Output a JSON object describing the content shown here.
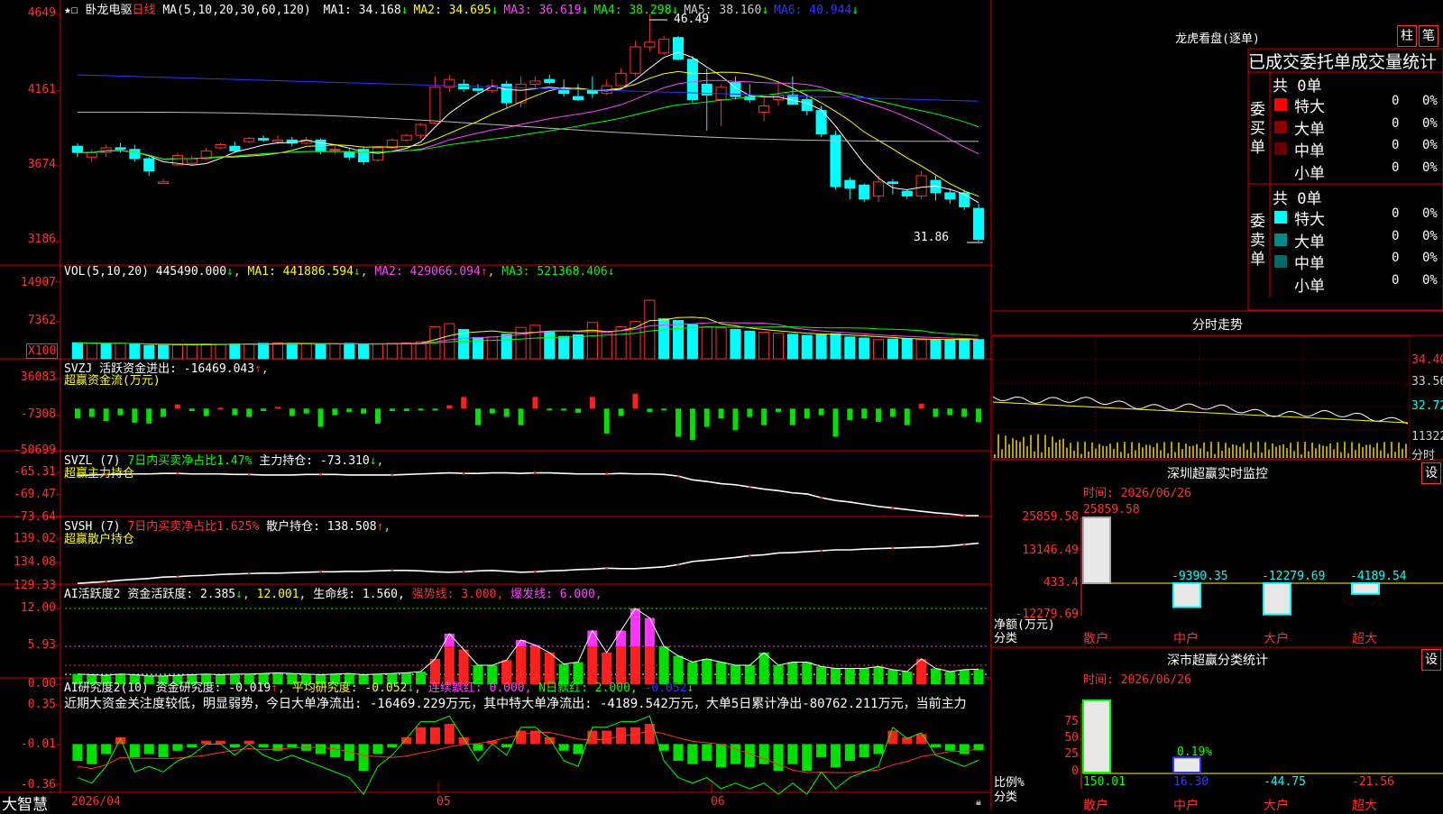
{
  "header": {
    "stock_name": "卧龙电驱",
    "period": "日线",
    "ma_params": "MA(5,10,20,30,60,120)",
    "ma": [
      {
        "label": "MA1: 34.168",
        "color": "#ffffff"
      },
      {
        "label": "MA2: 34.695",
        "color": "#ffff00"
      },
      {
        "label": "MA3: 36.619",
        "color": "#ff44ff"
      },
      {
        "label": "MA4: 38.298",
        "color": "#00ff00"
      },
      {
        "label": "MA5: 38.160",
        "color": "#cccccc"
      },
      {
        "label": "MA6: 40.944",
        "color": "#3333ff"
      }
    ]
  },
  "main_axis": [
    "4649",
    "4161",
    "3674",
    "3186"
  ],
  "price_annotations": {
    "high": "46.49",
    "low": "31.86"
  },
  "vol": {
    "title": "VOL(5,10,20)",
    "value": "445490.000",
    "ma1": "MA1: 441886.594",
    "ma2": "MA2: 429066.094",
    "ma3": "MA3: 521368.406",
    "axis": [
      "14907",
      "7362"
    ],
    "unit": "X100"
  },
  "svzj": {
    "title": "SVZJ",
    "label": "活跃资金进出: -16469.043",
    "sub": "超赢资金流(万元)",
    "axis": [
      "36083",
      "-7308",
      "-50699"
    ]
  },
  "svzl": {
    "title": "SVZL (7)",
    "label1": "7日内买卖净占比1.47%",
    "label2": "主力持仓: -73.310",
    "sub": "超赢主力持仓",
    "axis": [
      "-65.31",
      "-69.47",
      "-73.64"
    ]
  },
  "svsh": {
    "title": "SVSH (7)",
    "label1": "7日内买卖净占比1.625%",
    "label2": "散户持仓: 138.508",
    "sub": "超赢散户持仓",
    "axis": [
      "139.02",
      "134.08",
      "129.33"
    ]
  },
  "ai_active": {
    "title": "AI活跃度2",
    "l1": "资金活跃度: 2.385",
    "l2": "12.001,",
    "l3": "生命线: 1.560,",
    "l4": "强势线: 3.000,",
    "l5": "爆发线: 6.000,",
    "axis": [
      "12.00",
      "5.93",
      "0.00"
    ]
  },
  "ai_research": {
    "title": "AI研究度2(10)",
    "l1": "资金研究度: -0.019",
    "l2": "平均研究度: -0.052",
    "l3": "连续飘红: 0.000,",
    "l4": "N日飘红: 2.000,",
    "l5": "-0.052",
    "text": "近期大资金关注度较低，明显弱势，今日大单净流出: -16469.229万元，其中特大单净流出: -4189.542万元，大单5日累计净出-80762.211万元，当前主力",
    "axis": [
      "0.35",
      "-0.01",
      "-0.36"
    ]
  },
  "bottom": {
    "brand": "大智慧",
    "date": "2026/04",
    "m5": "05",
    "m6": "06"
  },
  "right": {
    "lhkp_title": "龙虎看盘(逐单)",
    "btn1": "柱",
    "btn2": "笔",
    "table_title": "已成交委托单成交量统计",
    "buy_label": "委买单",
    "sell_label": "委卖单",
    "buy_total": "共 0单",
    "sell_total": "共 0单",
    "buy_rows": [
      {
        "name": "特大",
        "val": "0",
        "pct": "0%",
        "color": "#ff0000"
      },
      {
        "name": "大单",
        "val": "0",
        "pct": "0%",
        "color": "#8b0000"
      },
      {
        "name": "中单",
        "val": "0",
        "pct": "0%",
        "color": "#6a0000"
      },
      {
        "name": "小单",
        "val": "0",
        "pct": "0%",
        "color": ""
      }
    ],
    "sell_rows": [
      {
        "name": "特大",
        "val": "0",
        "pct": "0%",
        "color": "#00ffff"
      },
      {
        "name": "大单",
        "val": "0",
        "pct": "0%",
        "color": "#008b8b"
      },
      {
        "name": "中单",
        "val": "0",
        "pct": "0%",
        "color": "#006a6a"
      },
      {
        "name": "小单",
        "val": "0",
        "pct": "0%",
        "color": ""
      }
    ],
    "fenshi_title": "分时走势",
    "fenshi_axis": [
      "34.40",
      "33.56",
      "32.72",
      "11322",
      "分时"
    ],
    "sz_title": "深圳超赢实时监控",
    "sz_btn": "设",
    "sz_time": "时间: 2026/06/26",
    "sz_axis": [
      "25859.58",
      "13146.49",
      "433.4",
      "-12279.69"
    ],
    "sz_ylabel": "净额(万元)",
    "sz_xlabel": "分类",
    "sz_bars": [
      {
        "cat": "散户",
        "value": 25859.58,
        "label": "25859.58",
        "label_color": "#ff3030"
      },
      {
        "cat": "中户",
        "value": -9390.35,
        "label": "-9390.35",
        "label_color": "#00ffff"
      },
      {
        "cat": "大户",
        "value": -12279.69,
        "label": "-12279.69",
        "label_color": "#00ffff"
      },
      {
        "cat": "超大",
        "value": -4189.54,
        "label": "-4189.54",
        "label_color": "#00ffff"
      }
    ],
    "ss_title": "深市超赢分类统计",
    "ss_btn": "设",
    "ss_time": "时间: 2026/06/26",
    "ss_axis": [
      "75",
      "50",
      "25",
      "0"
    ],
    "ss_ylabel": "比例%",
    "ss_xlabel": "分类",
    "ss_bars": [
      {
        "cat": "散户",
        "value": 150.01,
        "label": "150.01",
        "label_color": "#00ff00"
      },
      {
        "cat": "中户",
        "value": 16.3,
        "label": "16.30",
        "label_color": "#3333ff"
      },
      {
        "cat": "大户",
        "value": -44.75,
        "label": "-44.75",
        "label_color": "#00ffff"
      },
      {
        "cat": "超大",
        "value": -21.56,
        "label": "-21.56",
        "label_color": "#ff3030"
      }
    ],
    "ss_pct_label": "0.19%"
  },
  "chart_data": [
    {
      "type": "candlestick",
      "title": "卧龙电驱 日线",
      "ylim": [
        31.86,
        46.49
      ],
      "x": [
        "2026/04",
        "05",
        "06"
      ],
      "candles": [
        [
          38.0,
          38.2,
          37.3,
          37.6
        ],
        [
          37.3,
          37.8,
          37.0,
          37.6
        ],
        [
          37.6,
          38.1,
          37.3,
          37.9
        ],
        [
          37.9,
          38.2,
          37.6,
          37.8
        ],
        [
          37.8,
          38.1,
          37.0,
          37.2
        ],
        [
          37.2,
          37.3,
          36.1,
          36.4
        ],
        [
          35.6,
          35.9,
          35.6,
          35.7
        ],
        [
          36.8,
          37.6,
          36.7,
          37.4
        ],
        [
          36.9,
          37.4,
          36.8,
          37.2
        ],
        [
          37.2,
          37.9,
          37.1,
          37.7
        ],
        [
          37.9,
          38.2,
          37.8,
          38.1
        ],
        [
          38.0,
          38.3,
          37.6,
          37.7
        ],
        [
          38.3,
          38.6,
          38.2,
          38.5
        ],
        [
          38.5,
          38.7,
          38.3,
          38.4
        ],
        [
          38.3,
          38.7,
          38.1,
          38.4
        ],
        [
          38.4,
          38.6,
          38.0,
          38.2
        ],
        [
          38.2,
          38.6,
          38.1,
          38.4
        ],
        [
          38.4,
          38.5,
          37.5,
          37.7
        ],
        [
          37.8,
          38.0,
          37.5,
          37.8
        ],
        [
          37.6,
          37.9,
          37.1,
          37.3
        ],
        [
          37.8,
          38.0,
          36.8,
          37.0
        ],
        [
          37.1,
          38.0,
          37.0,
          37.9
        ],
        [
          37.9,
          38.5,
          37.8,
          38.4
        ],
        [
          38.4,
          38.8,
          38.3,
          38.7
        ],
        [
          38.7,
          39.5,
          38.5,
          39.4
        ],
        [
          39.5,
          42.5,
          39.4,
          41.8
        ],
        [
          41.8,
          42.6,
          41.5,
          42.3
        ],
        [
          42.0,
          42.3,
          41.5,
          41.7
        ],
        [
          41.7,
          42.0,
          41.4,
          41.6
        ],
        [
          41.6,
          42.3,
          41.4,
          41.9
        ],
        [
          42.0,
          42.2,
          40.5,
          40.8
        ],
        [
          40.8,
          42.5,
          40.5,
          42.0
        ],
        [
          42.0,
          42.5,
          41.8,
          42.2
        ],
        [
          42.3,
          42.6,
          42.0,
          42.1
        ],
        [
          41.6,
          42.3,
          41.2,
          41.4
        ],
        [
          41.2,
          42.0,
          40.9,
          41.0
        ],
        [
          41.6,
          42.5,
          41.1,
          41.4
        ],
        [
          41.4,
          42.3,
          41.3,
          41.9
        ],
        [
          41.9,
          43.0,
          41.8,
          42.7
        ],
        [
          42.7,
          44.8,
          42.5,
          44.4
        ],
        [
          44.4,
          46.49,
          44.1,
          44.7
        ],
        [
          44.0,
          45.1,
          43.9,
          44.9
        ],
        [
          45.0,
          45.1,
          43.5,
          43.6
        ],
        [
          43.6,
          43.8,
          40.8,
          41.0
        ],
        [
          42.0,
          43.0,
          39.0,
          41.3
        ],
        [
          41.0,
          42.0,
          39.3,
          41.8
        ],
        [
          42.1,
          42.5,
          41.0,
          41.2
        ],
        [
          41.2,
          42.0,
          40.8,
          41.0
        ],
        [
          40.2,
          41.2,
          39.6,
          40.6
        ],
        [
          41.0,
          42.0,
          40.6,
          41.3
        ],
        [
          41.3,
          42.5,
          40.7,
          40.7
        ],
        [
          41.0,
          41.2,
          40.0,
          40.3
        ],
        [
          40.3,
          40.6,
          38.6,
          38.8
        ],
        [
          38.7,
          39.0,
          35.2,
          35.4
        ],
        [
          35.8,
          36.0,
          34.6,
          35.3
        ],
        [
          35.5,
          35.6,
          34.4,
          34.6
        ],
        [
          34.8,
          36.1,
          34.4,
          35.7
        ],
        [
          35.7,
          35.9,
          34.9,
          35.6
        ],
        [
          35.1,
          35.2,
          34.6,
          34.8
        ],
        [
          34.8,
          36.4,
          34.6,
          36.1
        ],
        [
          35.8,
          36.1,
          34.5,
          35.0
        ],
        [
          35.0,
          35.3,
          34.3,
          34.6
        ],
        [
          35.0,
          35.2,
          33.9,
          34.1
        ],
        [
          34.0,
          34.3,
          31.86,
          32.0
        ]
      ]
    },
    {
      "type": "bar",
      "title": "VOL(5,10,20)",
      "ylim": [
        0,
        14907
      ],
      "values": [
        3000,
        2900,
        2800,
        2900,
        2700,
        2500,
        2500,
        2600,
        2700,
        2800,
        2700,
        2800,
        2800,
        2900,
        3000,
        2900,
        2800,
        2700,
        2800,
        2900,
        2700,
        2800,
        2900,
        3000,
        3200,
        6000,
        6600,
        5500,
        4000,
        4100,
        4600,
        5900,
        6300,
        5100,
        4200,
        4500,
        6800,
        5000,
        6000,
        7000,
        11000,
        7500,
        7200,
        6400,
        6000,
        5800,
        5500,
        5200,
        5000,
        4800,
        4600,
        4400,
        4500,
        4700,
        4100,
        3900,
        3600,
        3700,
        3800,
        3600,
        3500,
        3500,
        3800,
        3600
      ],
      "up": [
        false,
        true,
        false,
        true,
        false,
        false,
        false,
        true,
        true,
        true,
        true,
        false,
        true,
        false,
        true,
        false,
        true,
        false,
        true,
        false,
        false,
        true,
        true,
        true,
        true,
        true,
        true,
        false,
        false,
        true,
        false,
        true,
        true,
        false,
        false,
        false,
        true,
        true,
        true,
        true,
        true,
        false,
        false,
        false,
        true,
        true,
        false,
        false,
        true,
        true,
        false,
        false,
        false,
        false,
        false,
        false,
        true,
        false,
        false,
        true,
        false,
        false,
        false,
        false
      ]
    },
    {
      "type": "bar",
      "title": "SVZJ 活跃资金进出",
      "ylim": [
        -50699,
        36083
      ],
      "values": [
        -12000,
        -10000,
        -15000,
        -8000,
        -17000,
        -18000,
        -10000,
        5000,
        -3000,
        -9000,
        1000,
        -8000,
        -10000,
        -3000,
        2000,
        -9000,
        -6000,
        -22000,
        -8000,
        -4000,
        -6000,
        -18000,
        -3000,
        -3000,
        -2000,
        -1000,
        4000,
        14000,
        -20000,
        -6000,
        -10000,
        -20000,
        14000,
        -1000,
        -2000,
        -5000,
        14000,
        -30000,
        -9000,
        18000,
        -4000,
        -2000,
        -34000,
        -38000,
        -22000,
        -12000,
        -26000,
        -10000,
        -20000,
        -4000,
        -20000,
        -12000,
        -8000,
        -34000,
        -14000,
        -12000,
        -16000,
        -10000,
        -20000,
        6000,
        -10000,
        -8000,
        -10000,
        -16469
      ]
    },
    {
      "type": "line",
      "title": "SVZL 主力持仓",
      "ylim": [
        -73.64,
        -65.31
      ],
      "values": [
        -65.9,
        -65.8,
        -65.7,
        -65.7,
        -65.6,
        -65.6,
        -65.5,
        -65.5,
        -65.6,
        -65.6,
        -65.6,
        -65.7,
        -65.7,
        -65.8,
        -65.8,
        -65.8,
        -65.7,
        -65.7,
        -65.7,
        -65.8,
        -65.8,
        -65.8,
        -65.8,
        -65.7,
        -65.6,
        -65.5,
        -65.4,
        -65.5,
        -65.5,
        -65.4,
        -65.4,
        -65.5,
        -65.4,
        -65.4,
        -65.5,
        -65.6,
        -65.6,
        -65.6,
        -65.5,
        -65.6,
        -65.6,
        -65.7,
        -66.0,
        -66.7,
        -67.0,
        -67.4,
        -67.6,
        -68.0,
        -68.4,
        -68.7,
        -69.1,
        -69.3,
        -70.0,
        -70.5,
        -70.8,
        -71.2,
        -71.6,
        -71.9,
        -72.2,
        -72.5,
        -72.8,
        -73.0,
        -73.3,
        -73.31
      ]
    },
    {
      "type": "line",
      "title": "SVSH 散户持仓",
      "ylim": [
        129.33,
        139.02
      ],
      "values": [
        129.5,
        129.7,
        129.9,
        130.2,
        130.4,
        130.6,
        130.9,
        131.0,
        131.2,
        131.3,
        131.5,
        131.6,
        131.7,
        131.8,
        131.8,
        131.9,
        132.0,
        132.1,
        132.1,
        132.2,
        132.2,
        132.3,
        132.4,
        132.4,
        132.3,
        132.1,
        132.0,
        132.1,
        132.3,
        132.4,
        132.2,
        132.0,
        132.1,
        132.3,
        132.4,
        132.6,
        132.7,
        132.9,
        132.8,
        132.8,
        133.0,
        133.2,
        133.7,
        134.4,
        134.7,
        135.0,
        135.3,
        135.7,
        135.9,
        136.3,
        136.4,
        136.6,
        136.8,
        137.0,
        137.0,
        137.2,
        137.3,
        137.4,
        137.5,
        137.6,
        137.7,
        137.9,
        138.2,
        138.508
      ]
    },
    {
      "type": "bar",
      "title": "AI活跃度2 资金活跃度",
      "ylim": [
        0,
        12.0
      ],
      "values": [
        1.6,
        1.5,
        1.4,
        1.6,
        1.5,
        1.3,
        1.3,
        1.4,
        1.5,
        1.6,
        1.5,
        1.6,
        1.6,
        1.7,
        1.8,
        1.7,
        1.6,
        1.5,
        1.6,
        1.7,
        1.5,
        1.6,
        1.7,
        1.8,
        2.0,
        4.0,
        8.0,
        5.5,
        3.0,
        3.0,
        3.8,
        7.0,
        6.2,
        5.0,
        3.2,
        3.5,
        8.5,
        5.0,
        8.5,
        12.0,
        10.5,
        6.0,
        4.5,
        3.5,
        4.0,
        3.5,
        3.0,
        3.0,
        5.0,
        3.0,
        3.5,
        3.5,
        2.8,
        2.5,
        2.5,
        2.5,
        2.8,
        2.3,
        2.0,
        4.0,
        2.5,
        2.0,
        2.3,
        2.385
      ],
      "red": [
        false,
        false,
        false,
        false,
        false,
        false,
        false,
        false,
        false,
        false,
        false,
        false,
        false,
        false,
        false,
        false,
        false,
        false,
        false,
        false,
        false,
        false,
        false,
        false,
        false,
        true,
        true,
        true,
        false,
        false,
        true,
        true,
        true,
        true,
        false,
        false,
        true,
        true,
        true,
        true,
        true,
        false,
        false,
        false,
        false,
        false,
        false,
        false,
        false,
        false,
        false,
        false,
        false,
        false,
        false,
        false,
        false,
        false,
        false,
        true,
        false,
        false,
        false,
        false
      ]
    },
    {
      "type": "bar",
      "title": "AI研究度2(10) 资金研究度",
      "ylim": [
        -0.36,
        0.35
      ],
      "values": [
        -0.05,
        -0.06,
        -0.03,
        0.02,
        -0.04,
        -0.03,
        -0.04,
        -0.02,
        -0.01,
        0.01,
        0.01,
        -0.01,
        0.01,
        -0.01,
        -0.02,
        -0.01,
        -0.02,
        -0.03,
        -0.04,
        -0.05,
        -0.08,
        -0.03,
        -0.01,
        0.02,
        0.05,
        0.05,
        0.06,
        0.02,
        -0.02,
        0.01,
        -0.01,
        0.04,
        0.04,
        0.02,
        -0.02,
        -0.03,
        0.04,
        0.04,
        0.05,
        0.05,
        0.06,
        -0.02,
        -0.05,
        -0.06,
        -0.05,
        -0.07,
        -0.06,
        -0.07,
        -0.06,
        -0.08,
        -0.06,
        -0.08,
        -0.04,
        -0.07,
        -0.05,
        -0.04,
        -0.03,
        0.04,
        0.02,
        0.03,
        -0.01,
        -0.02,
        -0.03,
        -0.019
      ]
    }
  ]
}
